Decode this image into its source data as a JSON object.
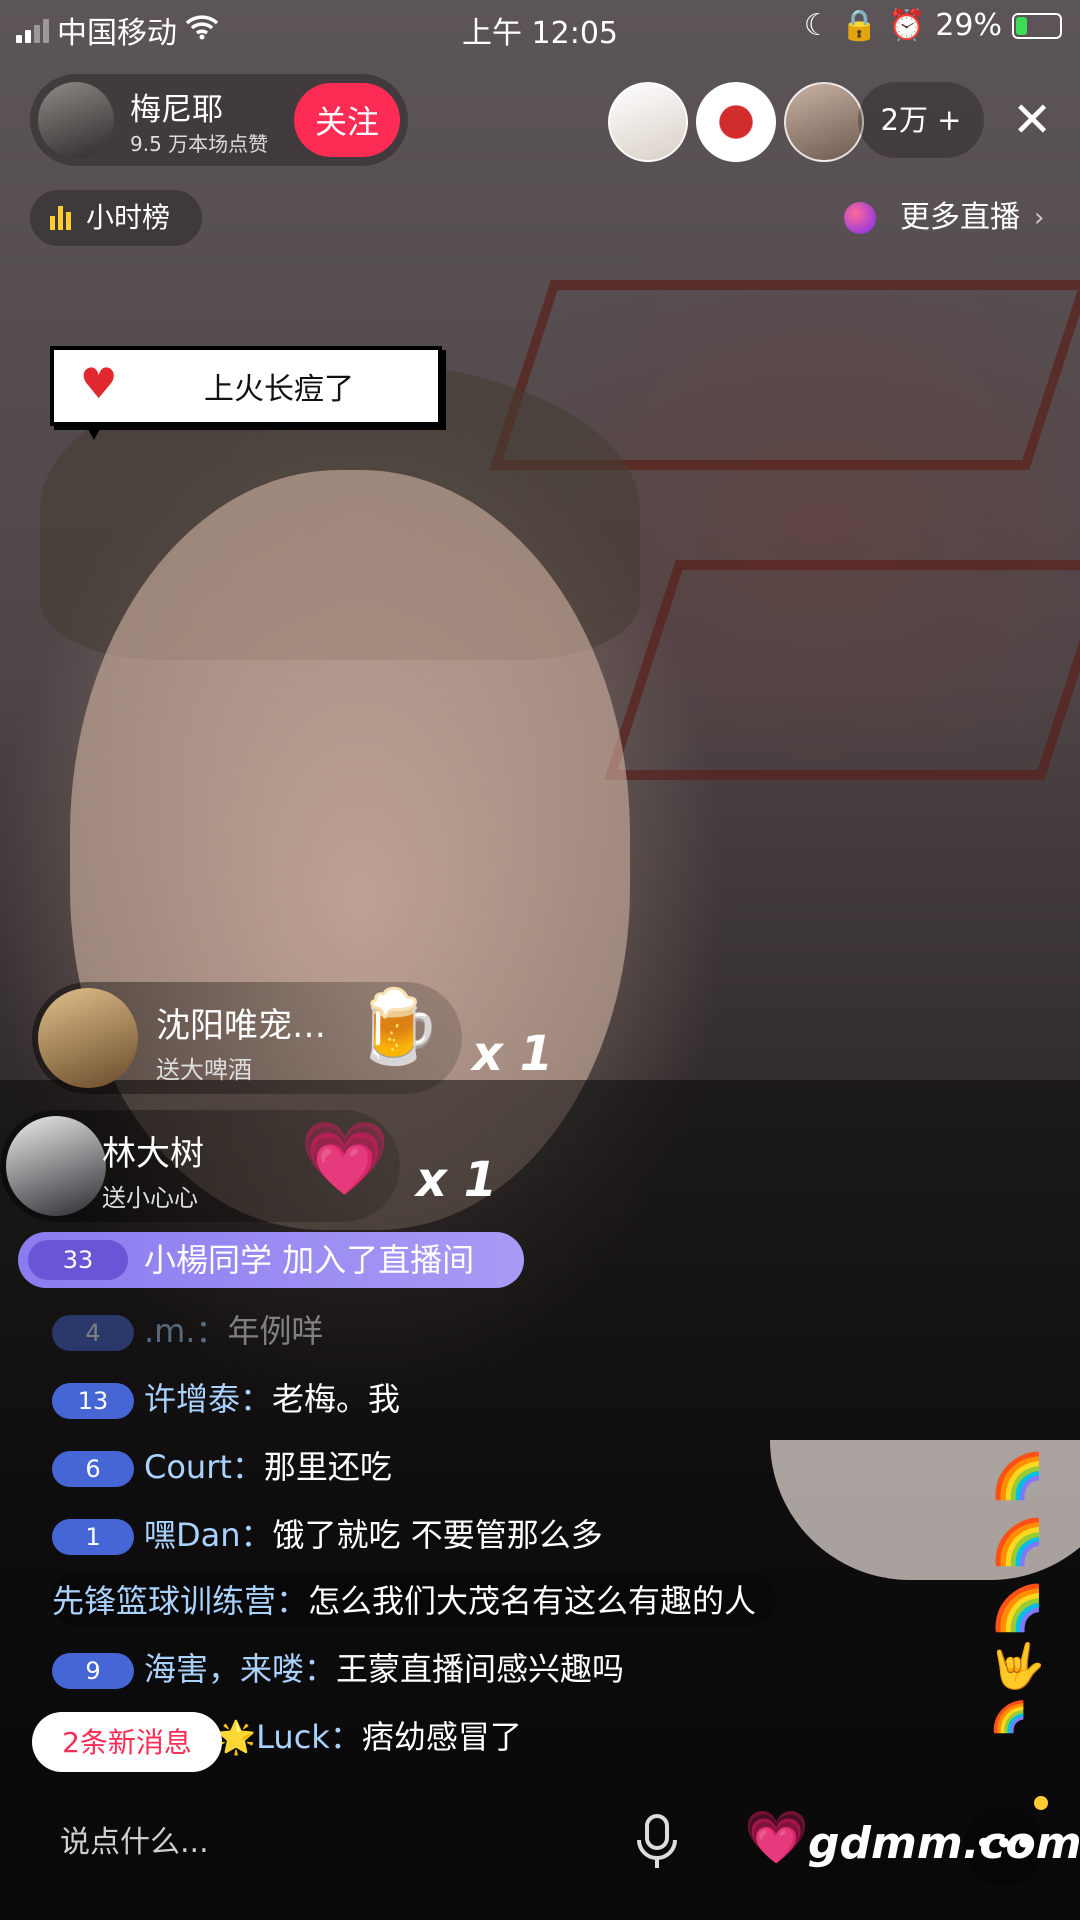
{
  "status_bar": {
    "carrier": "中国移动",
    "time": "上午 12:05",
    "battery": "29%",
    "battery_level": 0.29,
    "signal_bars": 2
  },
  "anchor": {
    "name": "梅尼耶",
    "likes": "9.5 万本场点赞",
    "follow_label": "关注"
  },
  "viewers": {
    "count": "2万 +",
    "close": "✕"
  },
  "rank": {
    "label": "小时榜"
  },
  "more_live": {
    "label": "更多直播",
    "chevron": "›"
  },
  "bubble": {
    "text": "上火长痘了",
    "icon": "heart-icon"
  },
  "gifts": [
    {
      "user": "沈阳唯宠…",
      "action": "送大啤酒",
      "icon": "beer-icon",
      "glyph": "🍺",
      "mult": "x 1"
    },
    {
      "user": "林大树",
      "action": "送小心心",
      "icon": "heart-planet-icon",
      "glyph": "💗",
      "mult": "x 1"
    }
  ],
  "join_banner": {
    "level": "33",
    "text": "小楊同学 加入了直播间"
  },
  "chat": [
    {
      "level": "4",
      "name": ".m.：",
      "msg": "年例咩"
    },
    {
      "level": "13",
      "name": "许增泰：",
      "msg": "老梅。我"
    },
    {
      "level": "6",
      "name": "Court：",
      "msg": "那里还吃"
    },
    {
      "level": "1",
      "name": "嘿Dan：",
      "msg": "饿了就吃 不要管那么多"
    },
    {
      "level": "",
      "name": "先锋篮球训练营：",
      "msg": "怎么我们大茂名有这么有趣的人"
    },
    {
      "level": "9",
      "name": "海害，来喽：",
      "msg": "王蒙直播间感兴趣吗"
    },
    {
      "level": "",
      "name": "d🌟Luck：",
      "msg": "痞幼感冒了"
    }
  ],
  "new_messages": "2条新消息",
  "bottom_bar": {
    "placeholder": "说点什么...",
    "watermark": "gdmm.com",
    "more": "•••"
  },
  "colors": {
    "follow": "#fe2c55",
    "chat_name": "#a9d2ff",
    "join_banner": "#8a7cf0"
  }
}
